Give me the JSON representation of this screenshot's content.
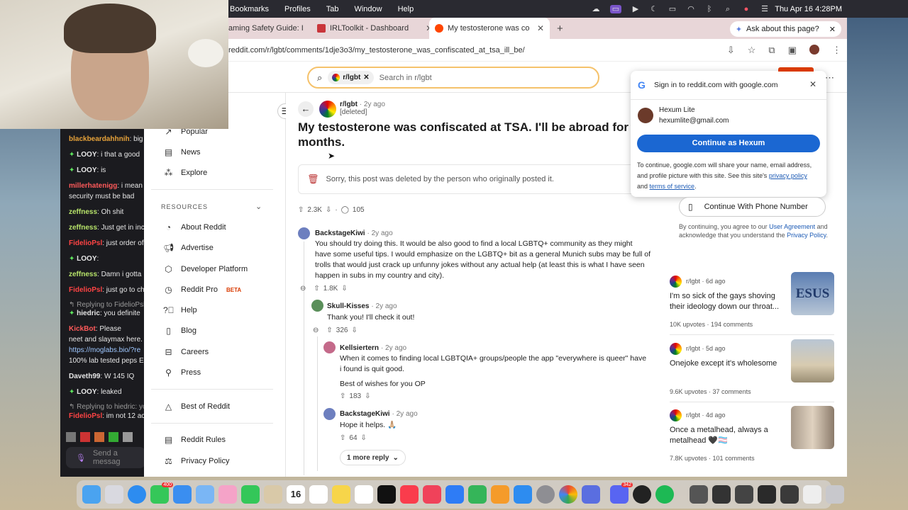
{
  "menubar": {
    "items": [
      "Bookmarks",
      "Profiles",
      "Tab",
      "Window",
      "Help"
    ],
    "clock": "Thu Apr 16  4:28PM"
  },
  "tabs": [
    {
      "label": "aming Safety Guide: I",
      "active": false
    },
    {
      "label": "IRLToolkit - Dashboard",
      "active": false
    },
    {
      "label": "My testosterone was confisca",
      "active": true
    }
  ],
  "ask_button": "Ask about this page?",
  "address_bar": {
    "url": "reddit.com/r/lgbt/comments/1dje3o3/my_testosterone_was_confiscated_at_tsa_ill_be/"
  },
  "search": {
    "chip": "r/lgbt",
    "placeholder": "Search in r/lgbt"
  },
  "left_nav": {
    "top_items": [
      {
        "label": "Popular",
        "icon": "popular-icon"
      },
      {
        "label": "News",
        "icon": "news-icon"
      },
      {
        "label": "Explore",
        "icon": "explore-icon"
      }
    ],
    "resources_header": "RESOURCES",
    "resources": [
      {
        "label": "About Reddit"
      },
      {
        "label": "Advertise"
      },
      {
        "label": "Developer Platform"
      },
      {
        "label": "Reddit Pro",
        "badge": "BETA"
      },
      {
        "label": "Help"
      },
      {
        "label": "Blog"
      },
      {
        "label": "Careers"
      },
      {
        "label": "Press"
      }
    ],
    "best_of": "Best of Reddit",
    "rules": "Reddit Rules",
    "privacy": "Privacy Policy"
  },
  "post": {
    "subreddit": "r/lgbt",
    "time": "· 2y ago",
    "author": "[deleted]",
    "title": "My testosterone was confiscated at TSA. I'll be abroad for months.",
    "deleted_notice": "Sorry, this post was deleted by the person who originally posted it.",
    "upvotes": "2.3K",
    "comments": "105"
  },
  "comments": [
    {
      "user": "BackstageKiwi",
      "time": "· 2y ago",
      "lines": [
        "You should try doing this. It would be also good to find a local LGBTQ+ community as they might",
        "have some useful tips. I would emphasize on the LGBTQ+ bit as a general Munich subs may be full of",
        "trolls that would just crack up unfunny jokes without any actual help (at least this is what I have seen",
        "happen in subs in my country and city)."
      ],
      "votes": "1.8K"
    },
    {
      "user": "Skull-Kisses",
      "time": "· 2y ago",
      "lines": [
        "Thank you! I'll check it out!"
      ],
      "votes": "326"
    },
    {
      "user": "Kellsiertern",
      "time": "· 2y ago",
      "lines": [
        "When it comes to finding local LGBTQIA+ groups/people the app \"everywhere is queer\" have",
        "i found is quit good."
      ],
      "extra": "Best of wishes for you OP",
      "votes": "183"
    },
    {
      "user": "BackstageKiwi",
      "time": "· 2y ago",
      "lines": [
        "Hope it helps. 🙏🏼"
      ],
      "votes": "64"
    }
  ],
  "more_reply": "1 more reply",
  "google_popup": {
    "title": "Sign in to reddit.com with google.com",
    "account_name": "Hexum Lite",
    "account_email": "hexumlite@gmail.com",
    "continue_button": "Continue as Hexum",
    "note_1": "To continue, google.com will share your name, email address,",
    "note_2": "and profile picture with this site. See this site's",
    "privacy_link": "privacy policy",
    "note_and": "and",
    "terms_link": "terms of service",
    "period": "."
  },
  "phone_button": "Continue With Phone Number",
  "agree": {
    "pre": "By continuing, you agree to our",
    "ua": "User Agreement",
    "mid": "and acknowledge that you understand the",
    "pp": "Privacy Policy",
    "end": "."
  },
  "related": [
    {
      "sub": "r/lgbt",
      "time": "· 6d ago",
      "title": "I'm so sick of the gays shoving their ideology down our throat...",
      "upvotes": "10K upvotes",
      "comments": "194 comments",
      "thumb_text": "ESUS"
    },
    {
      "sub": "r/lgbt",
      "time": "· 5d ago",
      "title": "Onejoke except it's wholesome",
      "upvotes": "9.6K upvotes",
      "comments": "37 comments"
    },
    {
      "sub": "r/lgbt",
      "time": "· 4d ago",
      "title": "Once a metalhead, always a metalhead 🖤🏳️‍⚧️",
      "upvotes": "7.8K upvotes",
      "comments": "101 comments"
    }
  ],
  "chat": {
    "lines": [
      {
        "name": "blackbeardahhnih",
        "color": "#e8a33a",
        "text": ": big"
      },
      {
        "name": "LOOY",
        "color": "#e6e6e6",
        "text": ": i that a good",
        "badge": true
      },
      {
        "name": "LOOY",
        "color": "#e6e6e6",
        "text": ": is",
        "badge": true
      },
      {
        "name": "millerhatenigg",
        "color": "#ff5a5a",
        "text": ": i mean"
      },
      {
        "name": "",
        "color": "#e6e6e6",
        "text": "security must be bad"
      },
      {
        "name": "zeffness",
        "color": "#b7e36a",
        "text": ": Oh shit"
      },
      {
        "name": "zeffness",
        "color": "#b7e36a",
        "text": ": Just get in inc"
      },
      {
        "name": "FidelioPsl",
        "color": "#ff4444",
        "text": ": just order of"
      },
      {
        "name": "LOOY",
        "color": "#e6e6e6",
        "text": ":",
        "badge": true
      },
      {
        "name": "zeffness",
        "color": "#b7e36a",
        "text": ": Damn i gotta"
      },
      {
        "name": "FidelioPsl",
        "color": "#ff4444",
        "text": ": just go to ch"
      },
      {
        "name": "",
        "color": "#999",
        "text": "↰ Replying to FidelioPsl:"
      },
      {
        "name": "hiedric",
        "color": "#e6e6e6",
        "text": ": you definite",
        "badge": true
      },
      {
        "name": "KickBot",
        "color": "#ff5a5a",
        "text": ": Please"
      },
      {
        "name": "",
        "color": "#e6e6e6",
        "text": "neet and slaymax here."
      },
      {
        "name": "",
        "color": "#9ec7ff",
        "text": "https://moglabs.bio/?re"
      },
      {
        "name": "",
        "color": "#e6e6e6",
        "text": "100% lab tested peps E"
      },
      {
        "name": "Daveth99",
        "color": "#e6e6e6",
        "text": ": W 145 IQ"
      },
      {
        "name": "LOOY",
        "color": "#e6e6e6",
        "text": ": leaked",
        "badge": true
      },
      {
        "name": "",
        "color": "#999",
        "text": "↰ Replying to hiedric: yo"
      },
      {
        "name": "FidelioPsl",
        "color": "#ff4444",
        "text": ": im not 12 act"
      }
    ],
    "input_placeholder": "Send a messag"
  },
  "dock": {
    "calendar_day": "16",
    "badge_a": "400",
    "badge_b": "342"
  }
}
